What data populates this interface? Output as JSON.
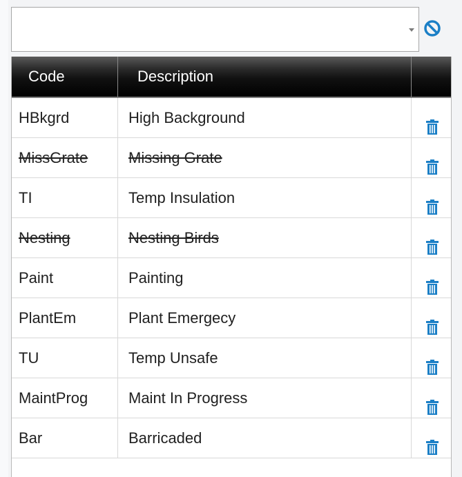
{
  "combo": {
    "value": ""
  },
  "grid": {
    "headers": {
      "code": "Code",
      "description": "Description",
      "actions": ""
    },
    "rows": [
      {
        "code": "HBkgrd",
        "description": "High Background",
        "inactive": false
      },
      {
        "code": "MissGrate",
        "description": "Missing Grate",
        "inactive": true
      },
      {
        "code": "TI",
        "description": "Temp Insulation",
        "inactive": false
      },
      {
        "code": "Nesting",
        "description": "Nesting Birds",
        "inactive": true
      },
      {
        "code": "Paint",
        "description": "Painting",
        "inactive": false
      },
      {
        "code": "PlantEm",
        "description": "Plant Emergecy",
        "inactive": false
      },
      {
        "code": "TU",
        "description": "Temp Unsafe",
        "inactive": false
      },
      {
        "code": "MaintProg",
        "description": "Maint In Progress",
        "inactive": false
      },
      {
        "code": "Bar",
        "description": "Barricaded",
        "inactive": false
      }
    ]
  },
  "icons": {
    "clear": "cancel-circle-icon",
    "delete": "trash-icon"
  },
  "colors": {
    "accent": "#1b7fc6",
    "header_bg": "#000000",
    "header_text": "#ffffff"
  }
}
